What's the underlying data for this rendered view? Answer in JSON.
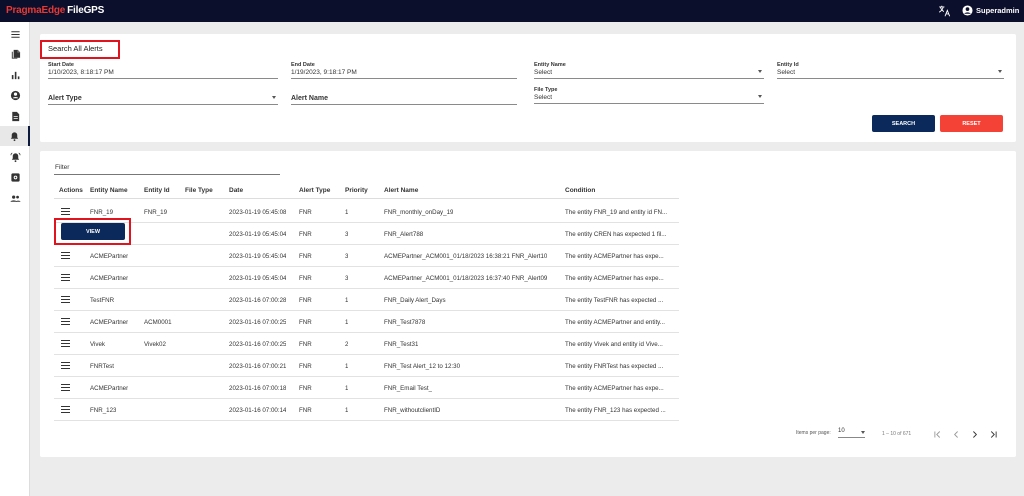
{
  "header": {
    "brand": "PragmaEdge",
    "product": "FileGPS",
    "user": "Superadmin"
  },
  "sidebar": [
    "menu-icon",
    "file-copy-icon",
    "bar-chart-icon",
    "account-circle-icon",
    "document-icon",
    "notification-bell-icon",
    "alert-bell-icon",
    "settings-icon",
    "people-icon"
  ],
  "search": {
    "title": "Search All Alerts",
    "start_date_label": "Start Date",
    "start_date": "1/10/2023, 8:18:17 PM",
    "end_date_label": "End Date",
    "end_date": "1/19/2023, 9:18:17 PM",
    "entity_name_label": "Entity Name",
    "entity_name": "Select",
    "entity_id_label": "Entity Id",
    "entity_id": "Select",
    "alert_type_label": "Alert Type",
    "alert_name_label": "Alert Name",
    "file_type_label": "File Type",
    "file_type": "Select",
    "search_button": "SEARCH",
    "reset_button": "RESET"
  },
  "table": {
    "filter_placeholder": "Filter",
    "columns": [
      "Actions",
      "Entity Name",
      "Entity Id",
      "File Type",
      "Date",
      "Alert Type",
      "Priority",
      "Alert Name",
      "Condition"
    ],
    "view_button": "VIEW",
    "rows": [
      {
        "entity_name": "FNR_19",
        "entity_id": "FNR_19",
        "file_type": "",
        "date": "2023-01-19 05:45:08",
        "alert_type": "FNR",
        "priority": "1",
        "alert_name": "FNR_monthly_onDay_19",
        "condition": "The entity FNR_19 and entity id FN..."
      },
      {
        "entity_name": "",
        "entity_id": "",
        "file_type": "",
        "date": "2023-01-19 05:45:04",
        "alert_type": "FNR",
        "priority": "3",
        "alert_name": "FNR_Alert788",
        "condition": "The entity CREN has expected 1 fil..."
      },
      {
        "entity_name": "ACMEPartner",
        "entity_id": "",
        "file_type": "",
        "date": "2023-01-19 05:45:04",
        "alert_type": "FNR",
        "priority": "3",
        "alert_name": "ACMEPartner_ACM001_01/18/2023 16:38:21 FNR_Alert10",
        "condition": "The entity ACMEPartner has expe..."
      },
      {
        "entity_name": "ACMEPartner",
        "entity_id": "",
        "file_type": "",
        "date": "2023-01-19 05:45:04",
        "alert_type": "FNR",
        "priority": "3",
        "alert_name": "ACMEPartner_ACM001_01/18/2023 16:37:40 FNR_Alert09",
        "condition": "The entity ACMEPartner has expe..."
      },
      {
        "entity_name": "TestFNR",
        "entity_id": "",
        "file_type": "",
        "date": "2023-01-16 07:00:28",
        "alert_type": "FNR",
        "priority": "1",
        "alert_name": "FNR_Daily Alert_Days",
        "condition": "The entity TestFNR has expected ..."
      },
      {
        "entity_name": "ACMEPartner",
        "entity_id": "ACM0001",
        "file_type": "",
        "date": "2023-01-16 07:00:25",
        "alert_type": "FNR",
        "priority": "1",
        "alert_name": "FNR_Test7878",
        "condition": "The entity ACMEPartner and entity..."
      },
      {
        "entity_name": "Vivek",
        "entity_id": "Vivek02",
        "file_type": "",
        "date": "2023-01-16 07:00:25",
        "alert_type": "FNR",
        "priority": "2",
        "alert_name": "FNR_Test31",
        "condition": "The entity Vivek and entity id Vive..."
      },
      {
        "entity_name": "FNRTest",
        "entity_id": "",
        "file_type": "",
        "date": "2023-01-16 07:00:21",
        "alert_type": "FNR",
        "priority": "1",
        "alert_name": "FNR_Test Alert_12 to 12:30",
        "condition": "The entity FNRTest has expected ..."
      },
      {
        "entity_name": "ACMEPartner",
        "entity_id": "",
        "file_type": "",
        "date": "2023-01-16 07:00:18",
        "alert_type": "FNR",
        "priority": "1",
        "alert_name": "FNR_Email Test_",
        "condition": "The entity ACMEPartner has expe..."
      },
      {
        "entity_name": "FNR_123",
        "entity_id": "",
        "file_type": "",
        "date": "2023-01-16 07:00:14",
        "alert_type": "FNR",
        "priority": "1",
        "alert_name": "FNR_withoutclientID",
        "condition": "The entity FNR_123 has expected ..."
      }
    ]
  },
  "paginator": {
    "items_per_page_label": "Items per page:",
    "items_per_page": "10",
    "range": "1 – 10 of 671"
  },
  "colors": {
    "topbar": "#0b0f2c",
    "brand_red": "#e53935",
    "primary": "#0b2a5b",
    "reset": "#f44336",
    "highlight": "#e0141e"
  }
}
